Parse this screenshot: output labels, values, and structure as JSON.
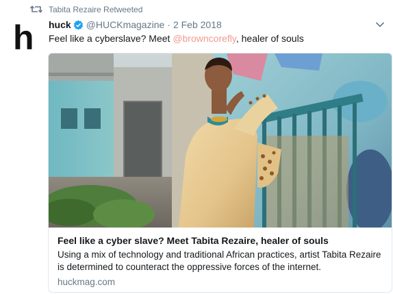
{
  "retweet": {
    "label": "Tabita Rezaire Retweeted"
  },
  "author": {
    "logo_text": "h",
    "name": "huck",
    "handle": "@HUCKmagazine",
    "separator": "·",
    "date": "2 Feb 2018"
  },
  "tweet": {
    "text_before": "Feel like a cyberslave? Meet ",
    "mention": "@browncorefly",
    "text_after": ", healer of souls"
  },
  "card": {
    "title": "Feel like a cyber slave? Meet Tabita Rezaire, healer of souls",
    "description": "Using a mix of technology and traditional African practices, artist Tabita Rezaire is determined to counteract the oppressive forces of the internet.",
    "domain": "huckmag.com"
  },
  "colors": {
    "verified": "#1da1f2",
    "mention": "#f2998e",
    "muted": "#657786"
  },
  "icons": [
    "retweet-icon",
    "verified-icon",
    "chevron-down-icon"
  ]
}
